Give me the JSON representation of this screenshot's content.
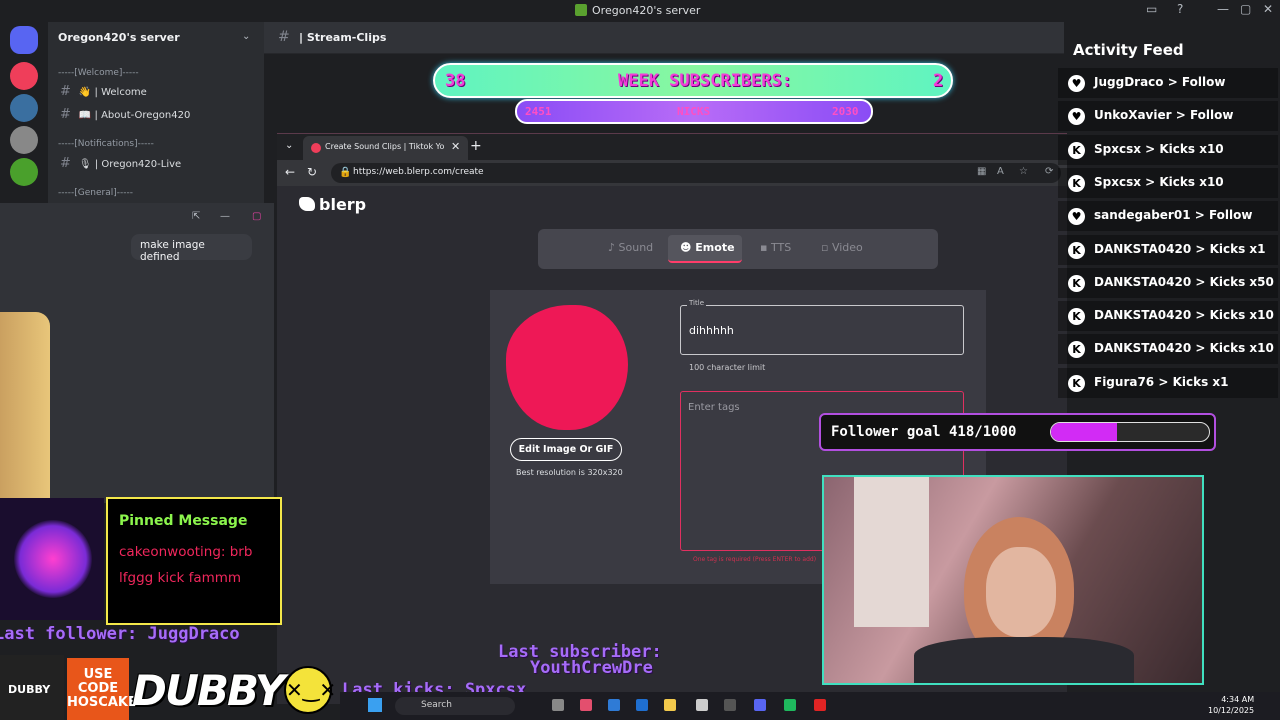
{
  "window": {
    "title": "Oregon420's server"
  },
  "discord": {
    "server_name": "Oregon420's server",
    "channel_header": "| Stream-Clips",
    "categories": [
      "-----[Welcome]-----",
      "-----[Notifications]-----",
      "-----[General]-----"
    ],
    "channels": [
      "👋 | Welcome",
      "📖 | About-Oregon420",
      "🎙 | Oregon420-Live"
    ]
  },
  "week_sub": {
    "left": "38",
    "label": "WEEK SUBSCRIBERS:",
    "right": "2",
    "bar_left": "2451",
    "bar_mid": "NICKS",
    "bar_right": "2030"
  },
  "browser": {
    "tab_title": "Create Sound Clips | Tiktok Youtube",
    "url": "https://web.blerp.com/create"
  },
  "blerp": {
    "logo": "blerp",
    "types": [
      "Sound",
      "Emote",
      "TTS",
      "Video"
    ],
    "edit_button": "Edit Image Or GIF",
    "best_res": "Best resolution is 320x320",
    "title_label": "Title",
    "title_value": "dihhhhh",
    "char_limit": "100 character limit",
    "tags_placeholder": "Enter tags",
    "tags_error": "One tag is required (Press ENTER to add)"
  },
  "chat_popup": {
    "message": "make image defined"
  },
  "pinned": {
    "header": "Pinned Message",
    "body": "cakeonwooting: brb lfggg kick fammm"
  },
  "tickers": {
    "last_follower": "Last follower: JuggDraco",
    "last_subscriber": "Last subscriber:",
    "last_subscriber_name": "YouthCrewDre",
    "last_kicks": "Last kicks: Spxcsx"
  },
  "activity": {
    "title": "Activity Feed",
    "items": [
      {
        "icon": "heart",
        "text": "JuggDraco > Follow"
      },
      {
        "icon": "heart",
        "text": "UnkoXavier > Follow"
      },
      {
        "icon": "kick",
        "text": "Spxcsx > Kicks x10"
      },
      {
        "icon": "kick",
        "text": "Spxcsx > Kicks x10"
      },
      {
        "icon": "heart",
        "text": "sandegaber01 > Follow"
      },
      {
        "icon": "kick",
        "text": "DANKSTA0420 > Kicks x1"
      },
      {
        "icon": "kick",
        "text": "DANKSTA0420 > Kicks x50"
      },
      {
        "icon": "kick",
        "text": "DANKSTA0420 > Kicks x10"
      },
      {
        "icon": "kick",
        "text": "DANKSTA0420 > Kicks x10"
      },
      {
        "icon": "kick",
        "text": "Figura76 > Kicks x1"
      }
    ]
  },
  "follower_goal": {
    "label": "Follower goal 418/1000",
    "current": 418,
    "target": 1000,
    "color": "#d22bf5"
  },
  "sponsor": {
    "use_code": "USE CODE HOSCAKE",
    "brand": "DUBBY",
    "jar": "DUBBY"
  },
  "taskbar": {
    "search": "Search",
    "time": "4:34 AM",
    "date": "10/12/2025"
  }
}
